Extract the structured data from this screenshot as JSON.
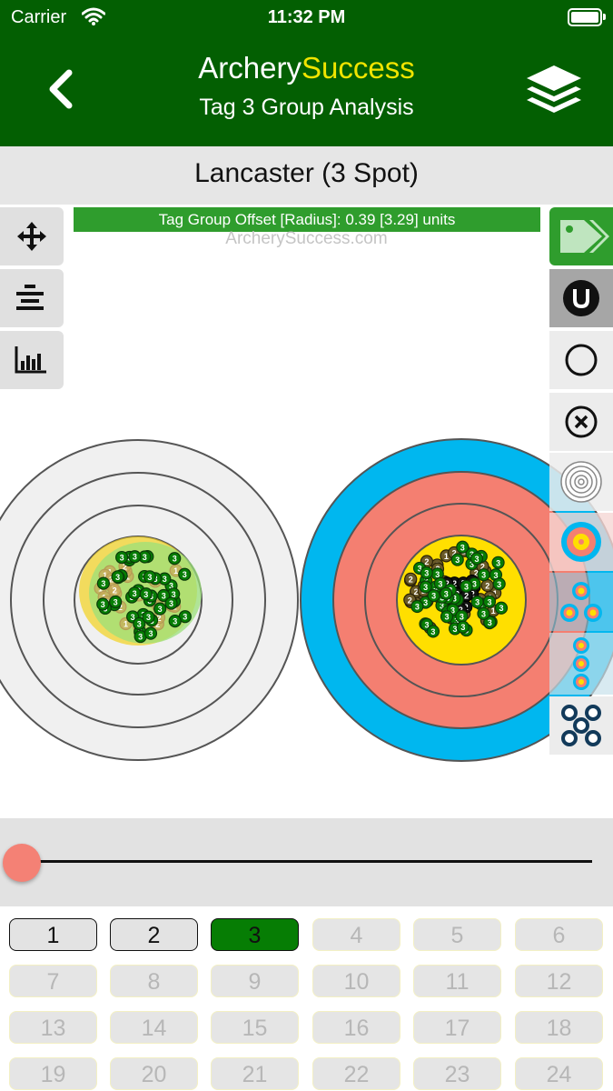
{
  "status_bar": {
    "carrier": "Carrier",
    "time": "11:32 PM"
  },
  "nav": {
    "title_part1": "Archery",
    "title_part2": "Success",
    "subtitle": "Tag 3 Group Analysis",
    "back_icon": "chevron-left-icon",
    "layers_icon": "layers-icon"
  },
  "target_name": "Lancaster (3 Spot)",
  "offset_banner": "Tag Group Offset [Radius]: 0.39 [3.29] units",
  "watermark": "ArcherySuccess.com",
  "left_tools": [
    {
      "icon": "move-arrows-icon"
    },
    {
      "icon": "align-center-icon"
    },
    {
      "icon": "bar-chart-icon"
    }
  ],
  "right_tools": [
    {
      "icon": "tag-icon",
      "state": "active"
    },
    {
      "icon": "horseshoe-u-icon",
      "state": "active"
    },
    {
      "icon": "circle-icon"
    },
    {
      "icon": "x-circle-icon"
    },
    {
      "icon": "concentric-rings-icon"
    },
    {
      "icon": "single-face-target-icon"
    },
    {
      "icon": "three-spot-triangle-icon"
    },
    {
      "icon": "three-spot-vertical-icon"
    },
    {
      "icon": "five-spot-icon"
    }
  ],
  "slider": {
    "value": 0
  },
  "colors": {
    "brand_green": "#035f02",
    "brand_yellow": "#f0e400",
    "target_blue": "#00b7ef",
    "target_red": "#f47f71",
    "target_gold": "#ffdf00",
    "tag3_green": "#067d04"
  },
  "tags": [
    {
      "label": "1",
      "state": "on"
    },
    {
      "label": "2",
      "state": "on"
    },
    {
      "label": "3",
      "state": "selected"
    },
    {
      "label": "4",
      "state": "off"
    },
    {
      "label": "5",
      "state": "off"
    },
    {
      "label": "6",
      "state": "off"
    },
    {
      "label": "7",
      "state": "off"
    },
    {
      "label": "8",
      "state": "off"
    },
    {
      "label": "9",
      "state": "off"
    },
    {
      "label": "10",
      "state": "off"
    },
    {
      "label": "11",
      "state": "off"
    },
    {
      "label": "12",
      "state": "off"
    },
    {
      "label": "13",
      "state": "off"
    },
    {
      "label": "14",
      "state": "off"
    },
    {
      "label": "15",
      "state": "off"
    },
    {
      "label": "16",
      "state": "off"
    },
    {
      "label": "17",
      "state": "off"
    },
    {
      "label": "18",
      "state": "off"
    },
    {
      "label": "19",
      "state": "off"
    },
    {
      "label": "20",
      "state": "off"
    },
    {
      "label": "21",
      "state": "off"
    },
    {
      "label": "22",
      "state": "off"
    },
    {
      "label": "23",
      "state": "off"
    },
    {
      "label": "24",
      "state": "off"
    }
  ]
}
